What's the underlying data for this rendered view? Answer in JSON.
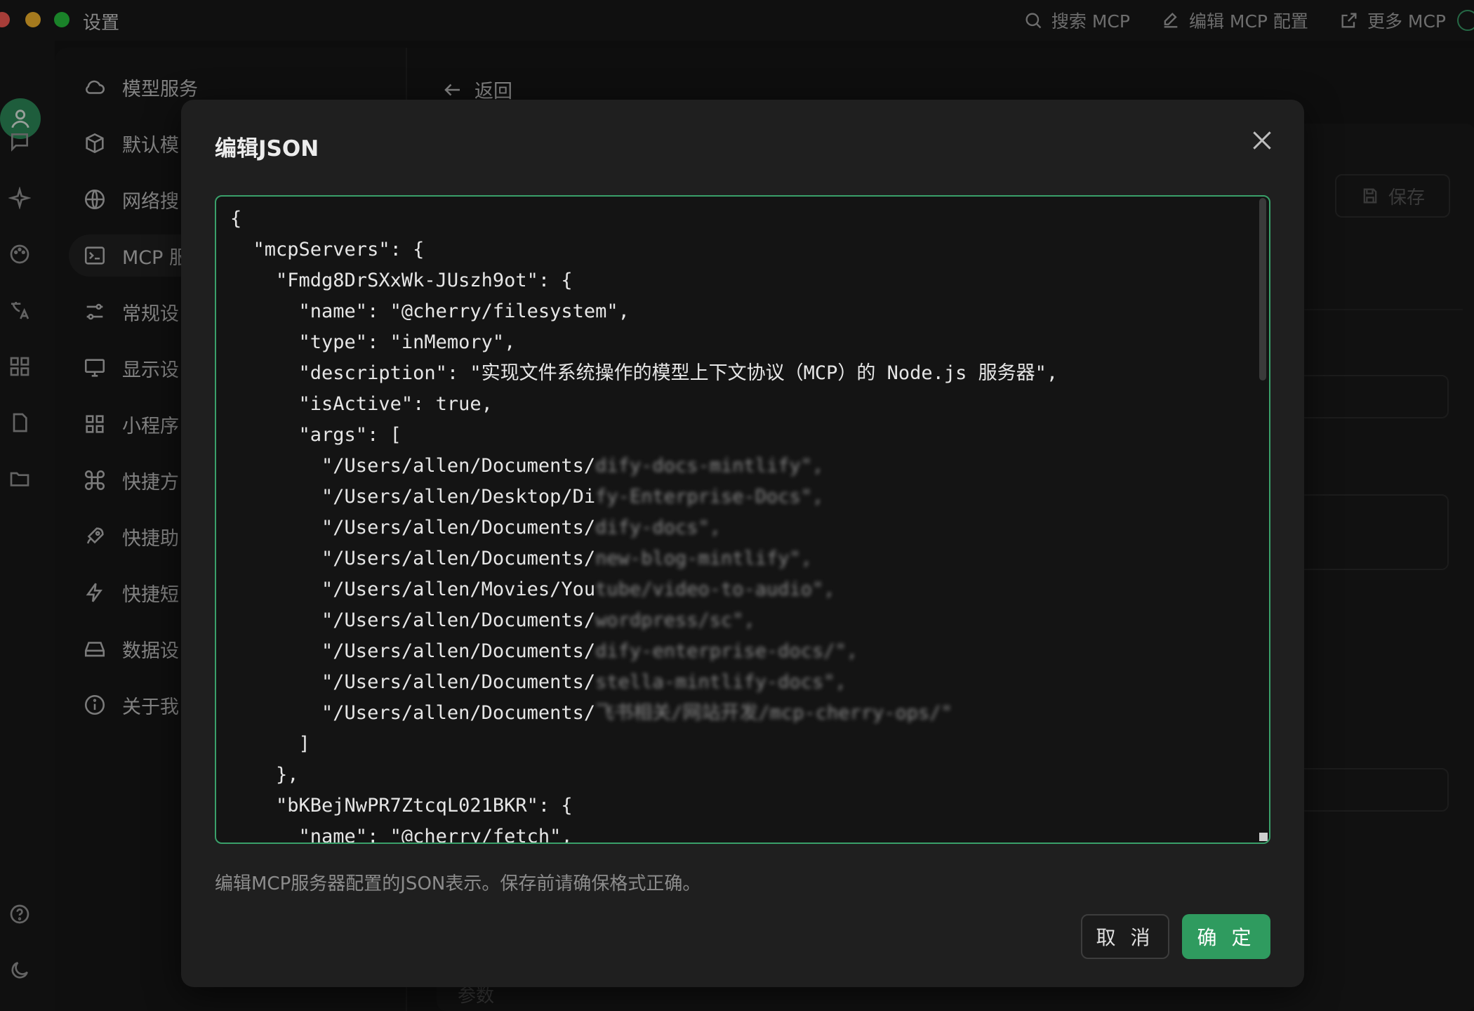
{
  "window": {
    "title": "设置"
  },
  "top_actions": [
    {
      "label": "搜索 MCP",
      "icon": "search-icon"
    },
    {
      "label": "编辑 MCP 配置",
      "icon": "edit-icon"
    },
    {
      "label": "更多 MCP",
      "icon": "external-link-icon"
    }
  ],
  "nav": {
    "items": [
      {
        "label": "模型服务",
        "icon": "cloud-icon"
      },
      {
        "label": "默认模",
        "icon": "cube-icon"
      },
      {
        "label": "网络搜",
        "icon": "globe-icon"
      },
      {
        "label": "MCP 服",
        "icon": "terminal-icon",
        "active": true
      },
      {
        "label": "常规设",
        "icon": "sliders-icon"
      },
      {
        "label": "显示设",
        "icon": "monitor-icon"
      },
      {
        "label": "小程序",
        "icon": "grid-icon"
      },
      {
        "label": "快捷方",
        "icon": "command-icon"
      },
      {
        "label": "快捷助",
        "icon": "rocket-icon"
      },
      {
        "label": "快捷短",
        "icon": "bolt-icon"
      },
      {
        "label": "数据设",
        "icon": "drive-icon"
      },
      {
        "label": "关于我",
        "icon": "info-icon"
      }
    ]
  },
  "content": {
    "back_label": "返回",
    "save_label": "保存",
    "bottom_label": "参数"
  },
  "modal": {
    "title": "编辑JSON",
    "hint": "编辑MCP服务器配置的JSON表示。保存前请确保格式正确。",
    "cancel_label": "取 消",
    "ok_label": "确 定",
    "code_lines": [
      {
        "text": "{",
        "blur": ""
      },
      {
        "text": "  \"mcpServers\": {",
        "blur": ""
      },
      {
        "text": "    \"Fmdg8DrSXxWk-JUszh9ot\": {",
        "blur": ""
      },
      {
        "text": "      \"name\": \"@cherry/filesystem\",",
        "blur": ""
      },
      {
        "text": "      \"type\": \"inMemory\",",
        "blur": ""
      },
      {
        "text": "      \"description\": \"实现文件系统操作的模型上下文协议（MCP）的 Node.js 服务器\",",
        "blur": ""
      },
      {
        "text": "      \"isActive\": true,",
        "blur": ""
      },
      {
        "text": "      \"args\": [",
        "blur": ""
      },
      {
        "text": "        \"/Users/allen/Documents/",
        "blur": "dify-docs-mintlify\","
      },
      {
        "text": "        \"/Users/allen/Desktop/Di",
        "blur": "fy-Enterprise-Docs\","
      },
      {
        "text": "        \"/Users/allen/Documents/",
        "blur": "dify-docs\","
      },
      {
        "text": "        \"/Users/allen/Documents/",
        "blur": "new-blog-mintlify\","
      },
      {
        "text": "        \"/Users/allen/Movies/You",
        "blur": "tube/video-to-audio\","
      },
      {
        "text": "        \"/Users/allen/Documents/",
        "blur": "wordpress/sc\","
      },
      {
        "text": "        \"/Users/allen/Documents/",
        "blur": "dify-enterprise-docs/\","
      },
      {
        "text": "        \"/Users/allen/Documents/",
        "blur": "stella-mintlify-docs\","
      },
      {
        "text": "        \"/Users/allen/Documents/",
        "blur": "飞书相关/网站开发/mcp-cherry-ops/\""
      },
      {
        "text": "      ]",
        "blur": ""
      },
      {
        "text": "    },",
        "blur": ""
      },
      {
        "text": "    \"bKBejNwPR7ZtcqL021BKR\": {",
        "blur": ""
      },
      {
        "text": "      \"name\": \"@cherry/fetch\",",
        "blur": ""
      }
    ]
  }
}
